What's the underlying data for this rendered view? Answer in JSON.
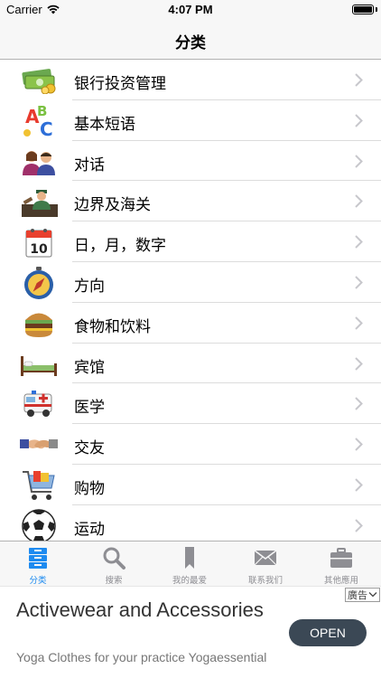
{
  "status_bar": {
    "carrier": "Carrier",
    "time": "4:07 PM",
    "wifi_icon": "wifi-icon",
    "battery_icon": "battery-icon"
  },
  "nav": {
    "title": "分类"
  },
  "categories": [
    {
      "label": "银行投资管理",
      "icon": "money-icon"
    },
    {
      "label": "基本短语",
      "icon": "abc-letters-icon"
    },
    {
      "label": "对话",
      "icon": "people-talking-icon"
    },
    {
      "label": "边界及海关",
      "icon": "customs-officer-icon"
    },
    {
      "label": "日，月，数字",
      "icon": "calendar-icon"
    },
    {
      "label": "方向",
      "icon": "compass-icon"
    },
    {
      "label": "食物和饮料",
      "icon": "burger-icon"
    },
    {
      "label": "宾馆",
      "icon": "bed-icon"
    },
    {
      "label": "医学",
      "icon": "ambulance-icon"
    },
    {
      "label": "交友",
      "icon": "handshake-icon"
    },
    {
      "label": "购物",
      "icon": "shopping-cart-icon"
    },
    {
      "label": "运动",
      "icon": "soccer-ball-icon"
    }
  ],
  "tabs": [
    {
      "label": "分类",
      "icon": "category-icon",
      "active": true
    },
    {
      "label": "搜索",
      "icon": "search-icon",
      "active": false
    },
    {
      "label": "我的最爱",
      "icon": "bookmark-icon",
      "active": false
    },
    {
      "label": "联系我们",
      "icon": "mail-icon",
      "active": false
    },
    {
      "label": "其他應用",
      "icon": "briefcase-icon",
      "active": false
    }
  ],
  "ad": {
    "badge": "廣告",
    "title": "Activewear and Accessories",
    "subtitle": "Yoga Clothes for your practice Yogaessential",
    "cta": "OPEN"
  },
  "colors": {
    "accent": "#1e8bf0",
    "tab_inactive": "#8e8e93",
    "bar_bg": "#f7f7f7",
    "cta_bg": "#3b4855"
  }
}
